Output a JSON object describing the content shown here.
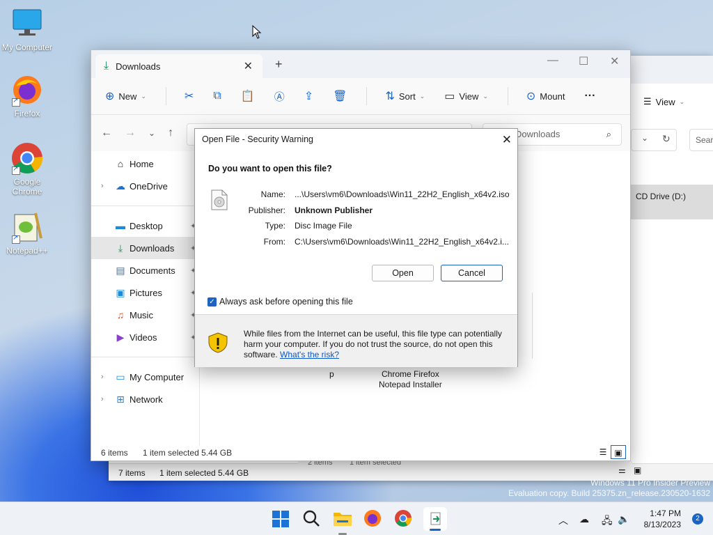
{
  "desktop": {
    "icons": [
      {
        "label": "My Computer"
      },
      {
        "label": "Firefox"
      },
      {
        "label": "Google Chrome"
      },
      {
        "label": "Notepad++"
      }
    ],
    "watermark": {
      "line1": "Windows 11 Pro Insider Preview",
      "line2": "Evaluation copy. Build 25375.zn_release.230520-1632"
    }
  },
  "bg_window": {
    "view_label": "View",
    "search_placeholder": "Sear",
    "drive_label": "CD Drive (D:)",
    "status_items": "7 items",
    "status_selected": "1 item selected  5.44 GB",
    "partial_status_items": "2 items",
    "partial_status_selected": "1 item selected"
  },
  "explorer": {
    "tab_title": "Downloads",
    "toolbar": {
      "new_label": "New",
      "sort_label": "Sort",
      "view_label": "View",
      "mount_label": "Mount"
    },
    "search_placeholder": "Downloads",
    "sidebar": {
      "home": "Home",
      "onedrive": "OneDrive",
      "desktop": "Desktop",
      "downloads": "Downloads",
      "documents": "Documents",
      "pictures": "Pictures",
      "music": "Music",
      "videos": "Videos",
      "mycomputer": "My Computer",
      "network": "Network"
    },
    "content_label_1": "Chrome Firefox",
    "content_label_2": "Notepad Installer",
    "content_label_p": "p",
    "status_items": "6 items",
    "status_selected": "1 item selected  5.44 GB"
  },
  "dialog": {
    "title": "Open File - Security Warning",
    "question": "Do you want to open this file?",
    "fields": {
      "name_key": "Name:",
      "name_val": "...\\Users\\vm6\\Downloads\\Win11_22H2_English_x64v2.iso",
      "publisher_key": "Publisher:",
      "publisher_val": "Unknown Publisher",
      "type_key": "Type:",
      "type_val": "Disc Image File",
      "from_key": "From:",
      "from_val": "C:\\Users\\vm6\\Downloads\\Win11_22H2_English_x64v2.i..."
    },
    "open_label": "Open",
    "cancel_label": "Cancel",
    "checkbox_label": "Always ask before opening this file",
    "warning_text": "While files from the Internet can be useful, this file type can potentially harm your computer. If you do not trust the source, do not open this software.",
    "risk_link": "What's the risk?"
  },
  "taskbar": {
    "time": "1:47 PM",
    "date": "8/13/2023",
    "notification_count": "2"
  },
  "colors": {
    "accent": "#1b63c5",
    "warning_yellow": "#f5c400"
  }
}
